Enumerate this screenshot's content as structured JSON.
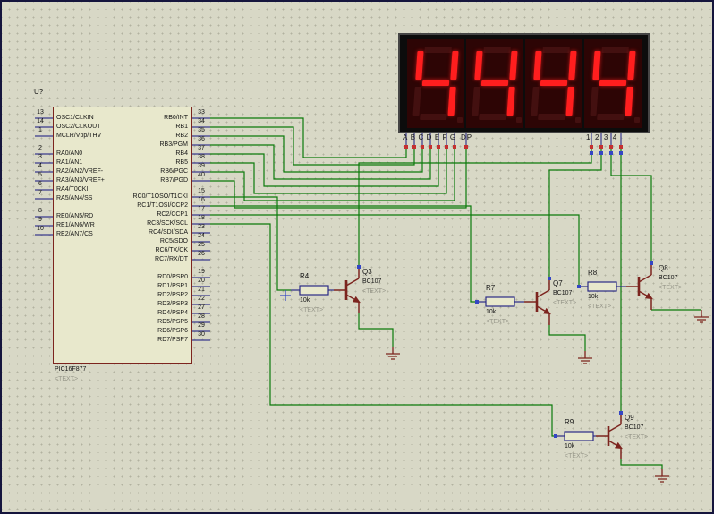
{
  "colors": {
    "wire": "#0b7a0b",
    "component": "#7c241e",
    "pin_stub": "#3a3a8c",
    "resistor_outline": "#2b2b85",
    "background": "#d8d8c6",
    "lit_segment": "#ff1e1e"
  },
  "chip": {
    "ref": "U?",
    "part": "PIC16F877",
    "placeholder": "<TEXT>",
    "left_pins": [
      {
        "num": "13",
        "label": "OSC1/CLKIN"
      },
      {
        "num": "14",
        "label": "OSC2/CLKOUT"
      },
      {
        "num": "1",
        "label": "MCLR/Vpp/THV"
      },
      {
        "num": "2",
        "label": "RA0/AN0"
      },
      {
        "num": "3",
        "label": "RA1/AN1"
      },
      {
        "num": "4",
        "label": "RA2/AN2/VREF-"
      },
      {
        "num": "5",
        "label": "RA3/AN3/VREF+"
      },
      {
        "num": "6",
        "label": "RA4/T0CKI"
      },
      {
        "num": "7",
        "label": "RA5/AN4/SS"
      },
      {
        "num": "8",
        "label": "RE0/AN5/RD"
      },
      {
        "num": "9",
        "label": "RE1/AN6/WR"
      },
      {
        "num": "10",
        "label": "RE2/AN7/CS"
      }
    ],
    "right_pins": [
      {
        "num": "33",
        "label": "RB0/INT"
      },
      {
        "num": "34",
        "label": "RB1"
      },
      {
        "num": "35",
        "label": "RB2"
      },
      {
        "num": "36",
        "label": "RB3/PGM"
      },
      {
        "num": "37",
        "label": "RB4"
      },
      {
        "num": "38",
        "label": "RB5"
      },
      {
        "num": "39",
        "label": "RB6/PGC"
      },
      {
        "num": "40",
        "label": "RB7/PGD"
      },
      {
        "num": "15",
        "label": "RC0/T1OSO/T1CKI"
      },
      {
        "num": "16",
        "label": "RC1/T1OSI/CCP2"
      },
      {
        "num": "17",
        "label": "RC2/CCP1"
      },
      {
        "num": "18",
        "label": "RC3/SCK/SCL"
      },
      {
        "num": "23",
        "label": "RC4/SDI/SDA"
      },
      {
        "num": "24",
        "label": "RC5/SDO"
      },
      {
        "num": "25",
        "label": "RC6/TX/CK"
      },
      {
        "num": "26",
        "label": "RC7/RX/DT"
      },
      {
        "num": "19",
        "label": "RD0/PSP0"
      },
      {
        "num": "20",
        "label": "RD1/PSP1"
      },
      {
        "num": "21",
        "label": "RD2/PSP2"
      },
      {
        "num": "22",
        "label": "RD3/PSP3"
      },
      {
        "num": "27",
        "label": "RD4/PSP4"
      },
      {
        "num": "28",
        "label": "RD5/PSP5"
      },
      {
        "num": "29",
        "label": "RD6/PSP6"
      },
      {
        "num": "30",
        "label": "RD7/PSP7"
      }
    ]
  },
  "display": {
    "digits": [
      "4",
      "4",
      "4",
      "4"
    ],
    "segments_label": "ABCDEFG",
    "dp_label": "DP",
    "digits_label": "1234"
  },
  "transistors": [
    {
      "ref": "Q3",
      "part": "BC107",
      "placeholder": "<TEXT>"
    },
    {
      "ref": "Q7",
      "part": "BC107",
      "placeholder": "<TEXT>"
    },
    {
      "ref": "Q8",
      "part": "BC107",
      "placeholder": "<TEXT>"
    },
    {
      "ref": "Q9",
      "part": "BC107",
      "placeholder": "<TEXT>"
    }
  ],
  "resistors": [
    {
      "ref": "R4",
      "value": "10k",
      "placeholder": "<TEXT>"
    },
    {
      "ref": "R7",
      "value": "10k",
      "placeholder": "<TEXT>"
    },
    {
      "ref": "R8",
      "value": "10k",
      "placeholder": "<TEXT>"
    },
    {
      "ref": "R9",
      "value": "10k",
      "placeholder": "<TEXT>"
    }
  ]
}
